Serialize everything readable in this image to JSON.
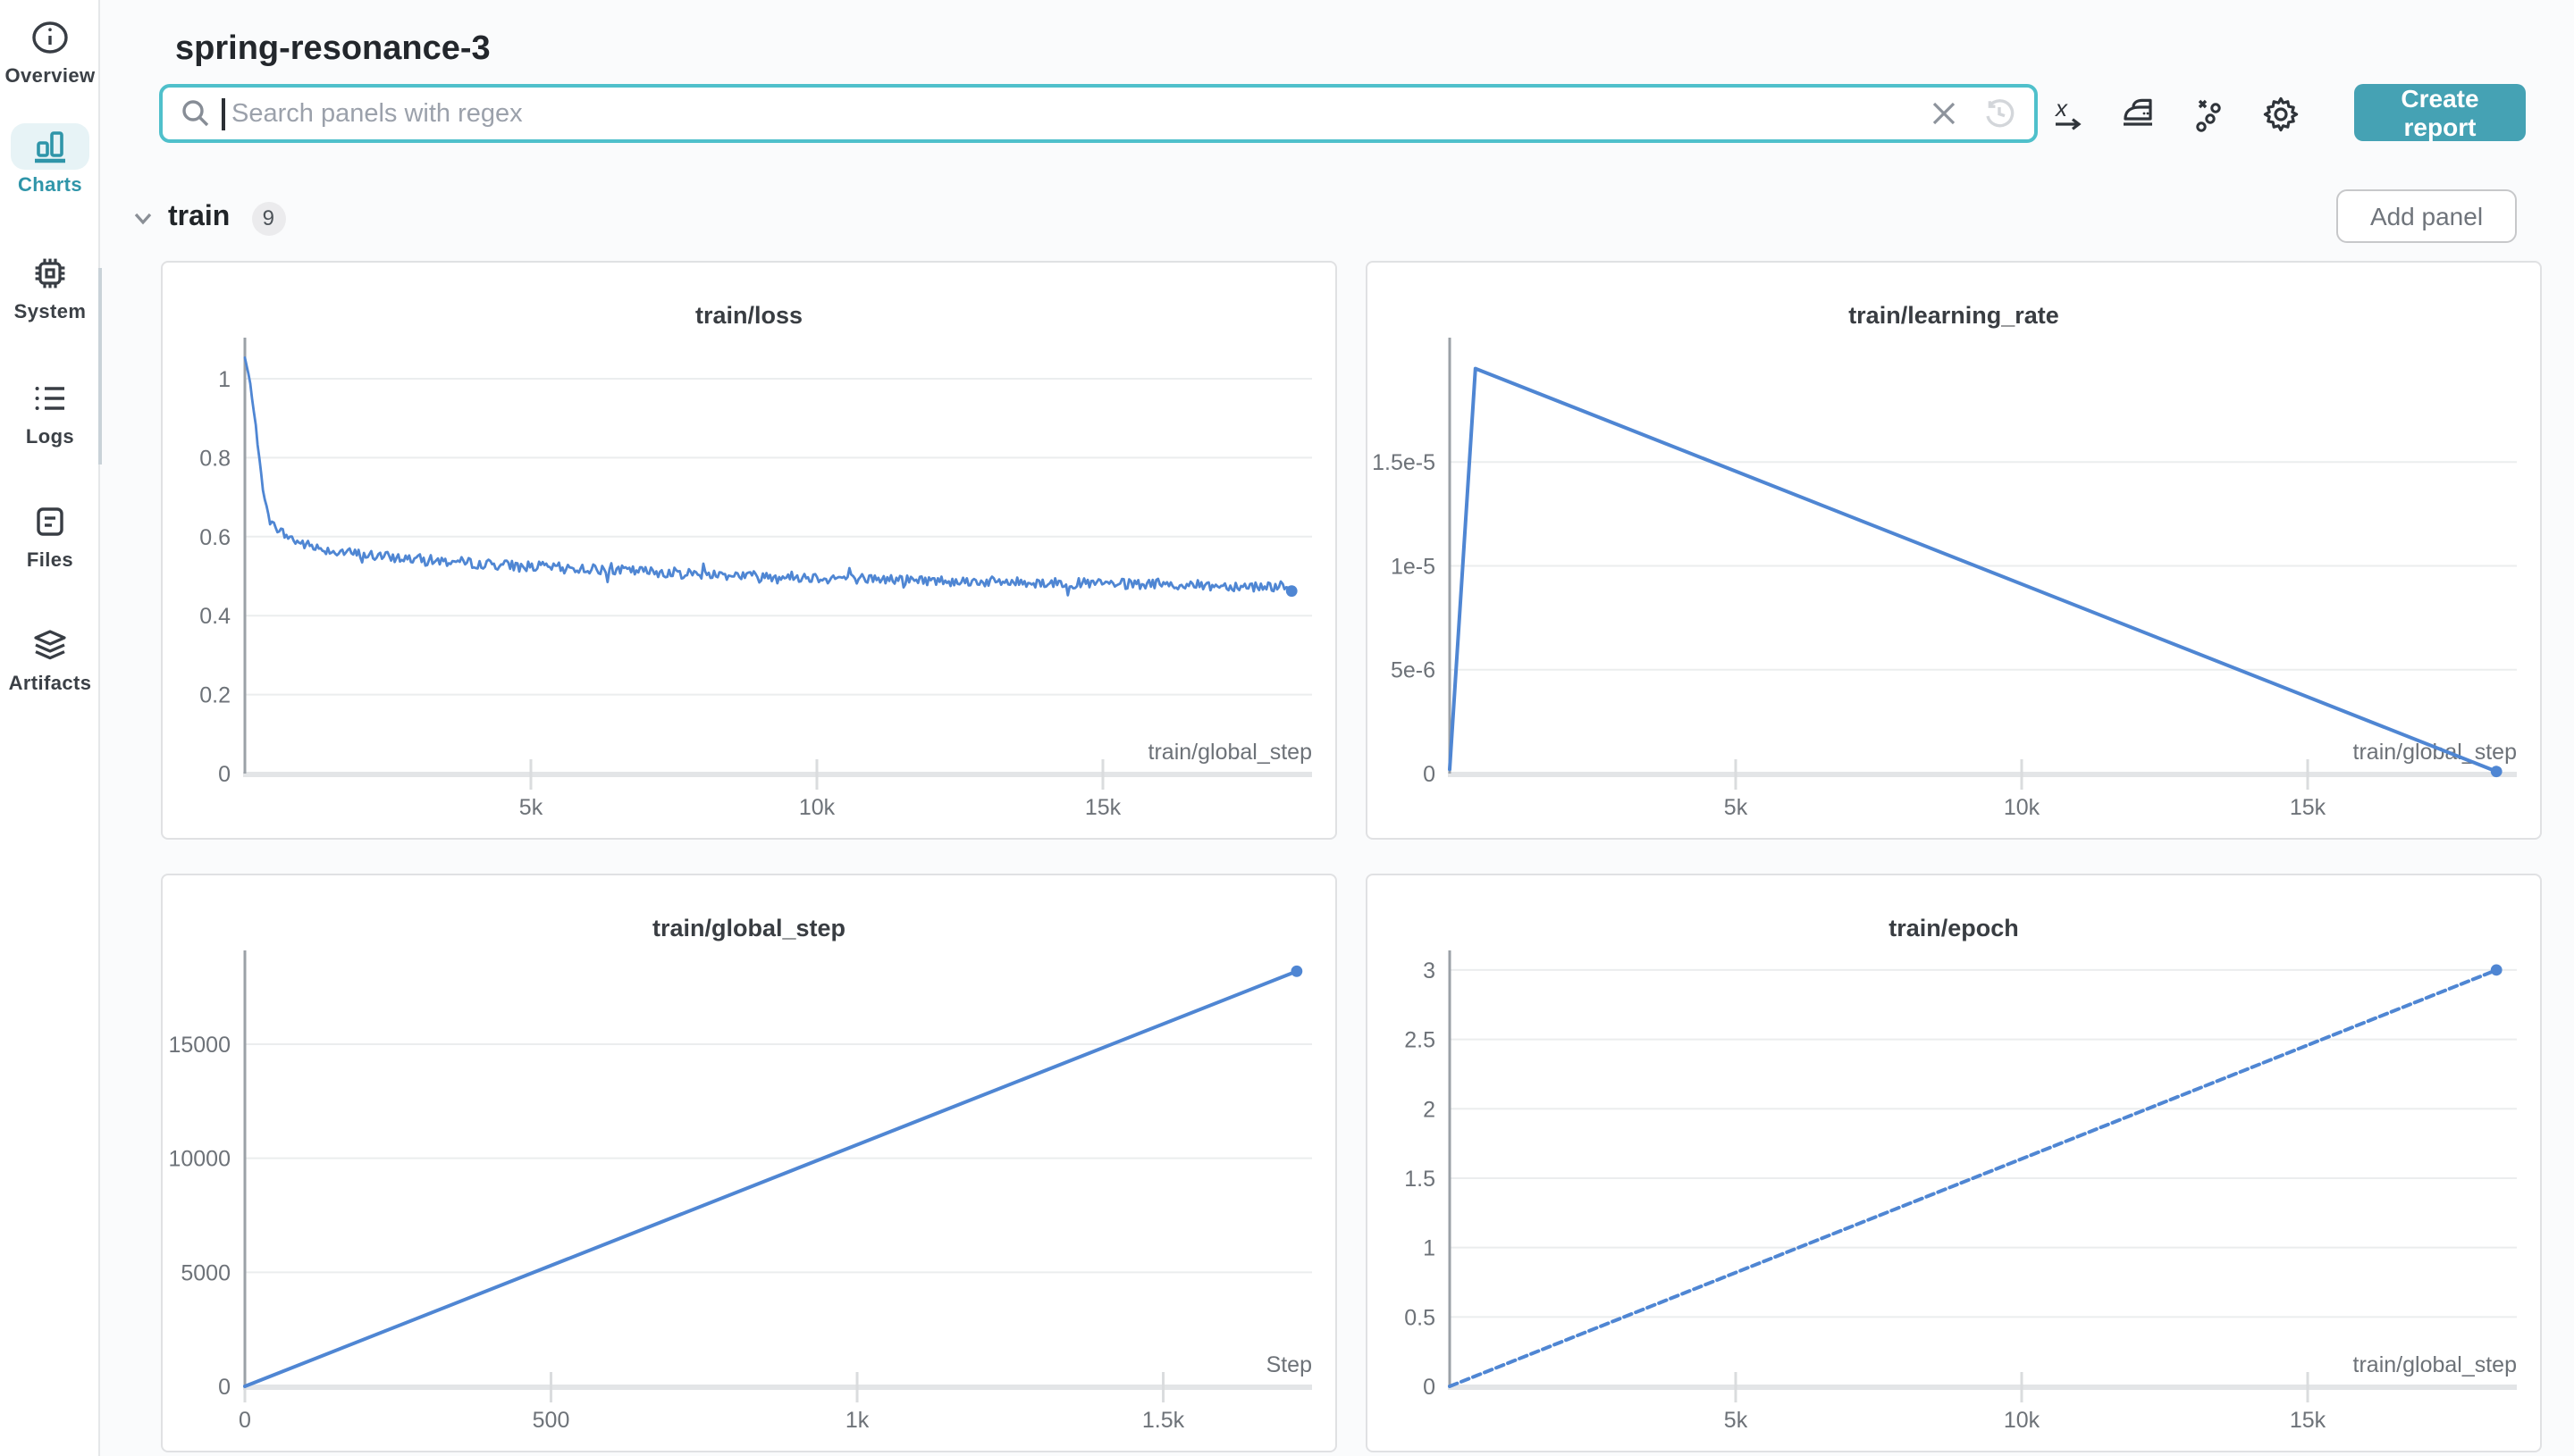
{
  "header": {
    "title": "spring-resonance-3"
  },
  "search": {
    "placeholder": "Search panels with regex"
  },
  "toolbar": {
    "create_report_label": "Create report"
  },
  "sidebar": {
    "items": [
      {
        "label": "Overview",
        "icon": "info-icon",
        "active": false
      },
      {
        "label": "Charts",
        "icon": "bar-chart-icon",
        "active": true
      },
      {
        "label": "System",
        "icon": "chip-icon",
        "active": false
      },
      {
        "label": "Logs",
        "icon": "list-icon",
        "active": false
      },
      {
        "label": "Files",
        "icon": "document-icon",
        "active": false
      },
      {
        "label": "Artifacts",
        "icon": "layers-icon",
        "active": false
      }
    ]
  },
  "section": {
    "name": "train",
    "count": "9",
    "add_panel_label": "Add panel"
  },
  "colors": {
    "accent_teal": "#45a2b4",
    "input_border_teal": "#4fc0cb",
    "active_teal": "#2f95a9",
    "line_blue": "#4f86d3"
  },
  "panels": [
    {
      "title": "train/loss",
      "chart_data": {
        "type": "line",
        "xlabel": "train/global_step",
        "x_max": 18656,
        "y_max": 1.0679,
        "y_ticks": [
          {
            "v": 0,
            "label": "0"
          },
          {
            "v": 0.2,
            "label": "0.2"
          },
          {
            "v": 0.4,
            "label": "0.4"
          },
          {
            "v": 0.6,
            "label": "0.6"
          },
          {
            "v": 0.8,
            "label": "0.8"
          },
          {
            "v": 1,
            "label": "1"
          }
        ],
        "x_ticks": [
          {
            "v": 5000,
            "label": "5k"
          },
          {
            "v": 10000,
            "label": "10k"
          },
          {
            "v": 15000,
            "label": "15k"
          }
        ],
        "series": [
          {
            "name": "train/loss",
            "style": "noisy",
            "noise": 0.013,
            "seed": 7,
            "end_dot": true,
            "keypoints": [
              [
                0,
                1.053
              ],
              [
                80,
                1.0
              ],
              [
                150,
                0.93
              ],
              [
                220,
                0.84
              ],
              [
                280,
                0.76
              ],
              [
                340,
                0.7
              ],
              [
                400,
                0.655
              ],
              [
                460,
                0.635
              ],
              [
                550,
                0.622
              ],
              [
                700,
                0.605
              ],
              [
                900,
                0.588
              ],
              [
                1100,
                0.578
              ],
              [
                1400,
                0.568
              ],
              [
                1800,
                0.559
              ],
              [
                2300,
                0.551
              ],
              [
                2900,
                0.544
              ],
              [
                3500,
                0.538
              ],
              [
                4200,
                0.531
              ],
              [
                5000,
                0.525
              ],
              [
                6000,
                0.518
              ],
              [
                7000,
                0.512
              ],
              [
                8000,
                0.506
              ],
              [
                9000,
                0.501
              ],
              [
                10000,
                0.497
              ],
              [
                11500,
                0.491
              ],
              [
                13000,
                0.486
              ],
              [
                14500,
                0.482
              ],
              [
                16000,
                0.478
              ],
              [
                17200,
                0.4755
              ],
              [
                18300,
                0.4735
              ]
            ]
          }
        ]
      }
    },
    {
      "title": "train/learning_rate",
      "chart_data": {
        "type": "line",
        "xlabel": "train/global_step",
        "x_max": 18656,
        "y_max": 2.03e-05,
        "y_ticks": [
          {
            "v": 0,
            "label": "0"
          },
          {
            "v": 5e-06,
            "label": "5e-6"
          },
          {
            "v": 1e-05,
            "label": "1e-5"
          },
          {
            "v": 1.5e-05,
            "label": "1.5e-5"
          }
        ],
        "x_ticks": [
          {
            "v": 5000,
            "label": "5k"
          },
          {
            "v": 10000,
            "label": "10k"
          },
          {
            "v": 15000,
            "label": "15k"
          }
        ],
        "series": [
          {
            "name": "train/learning_rate",
            "style": "plain",
            "end_dot": true,
            "keypoints": [
              [
                0,
                2e-07
              ],
              [
                450,
                1.95e-05
              ],
              [
                18300,
                1e-07
              ]
            ]
          }
        ]
      }
    },
    {
      "title": "train/global_step",
      "chart_data": {
        "type": "line",
        "xlabel": "Step",
        "x_max": 1743,
        "y_max": 18486,
        "y_ticks": [
          {
            "v": 0,
            "label": "0"
          },
          {
            "v": 5000,
            "label": "5000"
          },
          {
            "v": 10000,
            "label": "10000"
          },
          {
            "v": 15000,
            "label": "15000"
          }
        ],
        "x_ticks": [
          {
            "v": 0,
            "label": "0"
          },
          {
            "v": 500,
            "label": "500"
          },
          {
            "v": 1000,
            "label": "1k"
          },
          {
            "v": 1500,
            "label": "1.5k"
          }
        ],
        "series": [
          {
            "name": "train/global_step",
            "style": "plain",
            "end_dot": true,
            "keypoints": [
              [
                0,
                0
              ],
              [
                1718,
                18200
              ]
            ]
          }
        ]
      }
    },
    {
      "title": "train/epoch",
      "chart_data": {
        "type": "line",
        "xlabel": "train/global_step",
        "x_max": 18656,
        "y_max": 3.038,
        "y_ticks": [
          {
            "v": 0,
            "label": "0"
          },
          {
            "v": 0.5,
            "label": "0.5"
          },
          {
            "v": 1,
            "label": "1"
          },
          {
            "v": 1.5,
            "label": "1.5"
          },
          {
            "v": 2,
            "label": "2"
          },
          {
            "v": 2.5,
            "label": "2.5"
          },
          {
            "v": 3,
            "label": "3"
          }
        ],
        "x_ticks": [
          {
            "v": 5000,
            "label": "5k"
          },
          {
            "v": 10000,
            "label": "10k"
          },
          {
            "v": 15000,
            "label": "15k"
          }
        ],
        "series": [
          {
            "name": "train/epoch",
            "style": "plain",
            "dash": true,
            "end_dot": true,
            "keypoints": [
              [
                0,
                0
              ],
              [
                18300,
                3.0
              ]
            ]
          }
        ]
      }
    }
  ]
}
